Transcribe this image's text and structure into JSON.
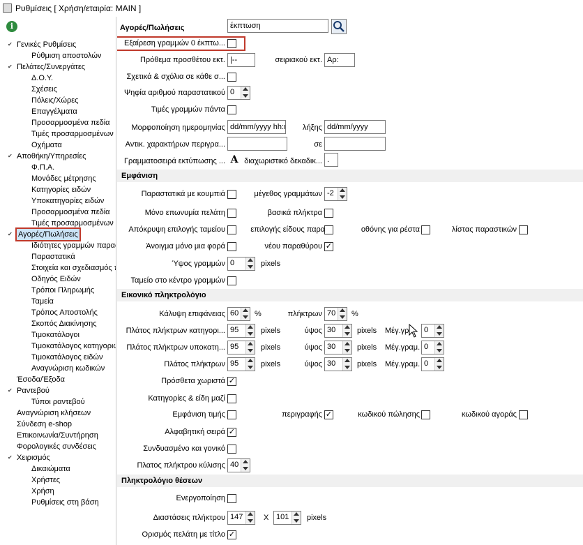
{
  "window": {
    "title": "Ρυθμίσεις   [ Χρήση/εταιρία: MAIN ]"
  },
  "sidebar": {
    "tree": [
      {
        "label": "Γενικές Ρυθμίσεις",
        "expanded": true
      },
      {
        "label": "Ρύθμιση αποστολών"
      },
      {
        "label": "Πελάτες/Συνεργάτες",
        "expanded": true
      },
      {
        "label": "Δ.Ο.Υ."
      },
      {
        "label": "Σχέσεις"
      },
      {
        "label": "Πόλεις/Χώρες"
      },
      {
        "label": "Επαγγέλματα"
      },
      {
        "label": "Προσαρμοσμένα πεδία"
      },
      {
        "label": "Τιμές προσαρμοσμένων π"
      },
      {
        "label": "Οχήματα"
      },
      {
        "label": "Αποθήκη/Υπηρεσίες",
        "expanded": true
      },
      {
        "label": "Φ.Π.Α."
      },
      {
        "label": "Μονάδες μέτρησης"
      },
      {
        "label": "Κατηγορίες ειδών"
      },
      {
        "label": "Υποκατηγορίες ειδών"
      },
      {
        "label": "Προσαρμοσμένα πεδία"
      },
      {
        "label": "Τιμές προσαρμοσμένων π"
      },
      {
        "label": "Αγορές/Πωλήσεις",
        "expanded": true,
        "selected": true
      },
      {
        "label": "Ιδιότητες γραμμών παρασ"
      },
      {
        "label": "Παραστατικά"
      },
      {
        "label": "Στοιχεία και σχεδιασμός π"
      },
      {
        "label": "Οδηγός Ειδών"
      },
      {
        "label": "Τρόποι Πληρωμής"
      },
      {
        "label": "Ταμεία"
      },
      {
        "label": "Τρόπος Αποστολής"
      },
      {
        "label": "Σκοπός Διακίνησης"
      },
      {
        "label": "Τιμοκατάλογοι"
      },
      {
        "label": "Τιμοκατάλογος κατηγοριώ"
      },
      {
        "label": "Τιμοκατάλογος ειδών"
      },
      {
        "label": "Αναγνώριση κωδικών"
      },
      {
        "label": "Έσοδα/Έξοδα"
      },
      {
        "label": "Ραντεβού",
        "expanded": true
      },
      {
        "label": "Τύποι ραντεβού"
      },
      {
        "label": "Αναγνώριση κλήσεων"
      },
      {
        "label": "Σύνδεση e-shop"
      },
      {
        "label": "Επικοινωνία/Συντήρηση"
      },
      {
        "label": "Φορολογικές συνδέσεις"
      },
      {
        "label": "Χειρισμός",
        "expanded": true
      },
      {
        "label": "Δικαιώματα"
      },
      {
        "label": "Χρήστες"
      },
      {
        "label": "Χρήση"
      },
      {
        "label": "Ρυθμίσεις στη βάση"
      }
    ]
  },
  "main": {
    "heading": "Αγορές/Πωλήσεις",
    "search_value": "έκπτωση",
    "f": {
      "exclude_zero": "Εξαίρεση γραμμών 0 έκπτω...",
      "prefix_label": "Πρόθεμα προσθέτου εκτ.",
      "prefix_value": "|--",
      "serial_label": "σειριακού εκτ.",
      "serial_value": "Αρ:",
      "notes_label": "Σχετικά & σχόλια σε κάθε σ...",
      "digits_label": "Ψηφία αριθμού παραστατικού",
      "digits_value": "0",
      "line_prices_label": "Τιμές γραμμών πάντα",
      "date_format_label": "Μορφοποίηση ημερομηνίας",
      "date_format_value": "dd/mm/yyyy hh:m",
      "expiry_label": "λήξης",
      "expiry_value": "dd/mm/yyyy",
      "replace_chars_label": "Αντικ. χαρακτήρων περιγρα...",
      "to_label": "σε",
      "print_font_label": "Γραμματοσειρά εκτύπωσης ...",
      "font_glyph": "A",
      "decimal_sep_label": "διαχωριστικό δεκαδικ...",
      "decimal_sep_value": "."
    },
    "appearance": {
      "section": "Εμφάνιση",
      "docs_buttons": "Παραστατικά με κουμπιά",
      "line_size_label": "μέγεθος γραμμάτων",
      "line_size_value": "-2",
      "only_brand": "Μόνο επωνυμία πελάτη",
      "basic_keys": "βασικά πλήκτρα",
      "hide_cash": "Απόκρυψη επιλογής ταμείου",
      "doc_type": "επιλογής είδους παρασ.",
      "change_screen": "οθόνης για ρέστα",
      "doc_list": "λίστας παραστικών",
      "open_once": "Άνοιγμα μόνο μια φορά",
      "new_window": "νέου παραθύρου",
      "line_height_label": "Ύψος γραμμών",
      "line_height_value": "0",
      "pixels": "pixels",
      "cash_center": "Ταμείο στο κέντρο γραμμών"
    },
    "keyboard": {
      "section": "Εικονικό πληκτρολόγιο",
      "coverage_label": "Κάλυψη επιφάνειας",
      "coverage_value": "60",
      "percent": "%",
      "keys_label": "πλήκτρων",
      "keys_value": "70",
      "cat_width_label": "Πλάτος πλήκτρων κατηγορι...",
      "subcat_width_label": "Πλάτος πλήκτρων υποκατη...",
      "key_width_label": "Πλάτος πλήκτρων",
      "width_value": "95",
      "height_label": "ύψος",
      "height_value": "30",
      "maxchars1": "Μέγ.γρ",
      "maxchars": "Μέγ.γραμ.",
      "max_value": "0",
      "extra_separate": "Πρόσθετα χωριστά",
      "cats_items_together": "Κατηγορίες & είδη μαζί",
      "show_price": "Εμφάνιση τιμής",
      "description": "περιγραφής",
      "sale_code": "κωδικού πώλησης",
      "purchase_code": "κωδικού αγοράς",
      "alpha_order": "Αλφαβητική σειρά",
      "combined_parent": "Συνδυασμένο και γονικό",
      "scroll_width_label": "Πλατος πλήκτρου κύλισης",
      "scroll_width_value": "40"
    },
    "positions": {
      "section": "Πληκτρολόγιο θέσεων",
      "enable": "Ενεργοποίηση",
      "dims_label": "Διαστάσεις πλήκτρου",
      "dims_w": "147",
      "x": "X",
      "dims_h": "101",
      "customer_title": "Ορισμός πελάτη με τίτλο"
    },
    "checked": "✓"
  }
}
